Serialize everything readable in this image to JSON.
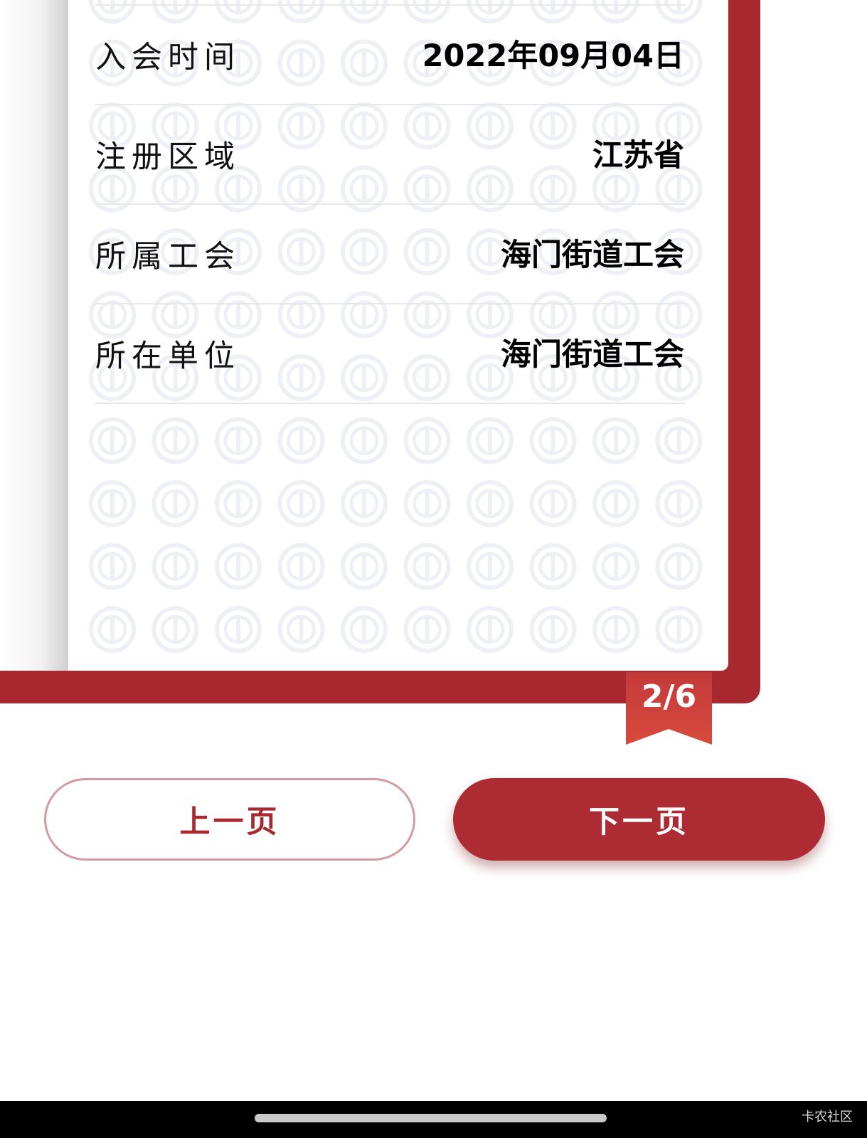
{
  "info_rows": [
    {
      "label": "入会时间",
      "value": "2022年09月04日"
    },
    {
      "label": "注册区域",
      "value": "江苏省"
    },
    {
      "label": "所属工会",
      "value": "海门街道工会"
    },
    {
      "label": "所在单位",
      "value": "海门街道工会"
    }
  ],
  "pagination": {
    "indicator": "2/6",
    "current_page": 2,
    "total_pages": 6
  },
  "buttons": {
    "prev_label": "上一页",
    "next_label": "下一页"
  },
  "watermark": "卡农社区",
  "colors": {
    "brand_red": "#a8282f",
    "button_red": "#ad2b33",
    "pattern": "#eef0f6"
  }
}
